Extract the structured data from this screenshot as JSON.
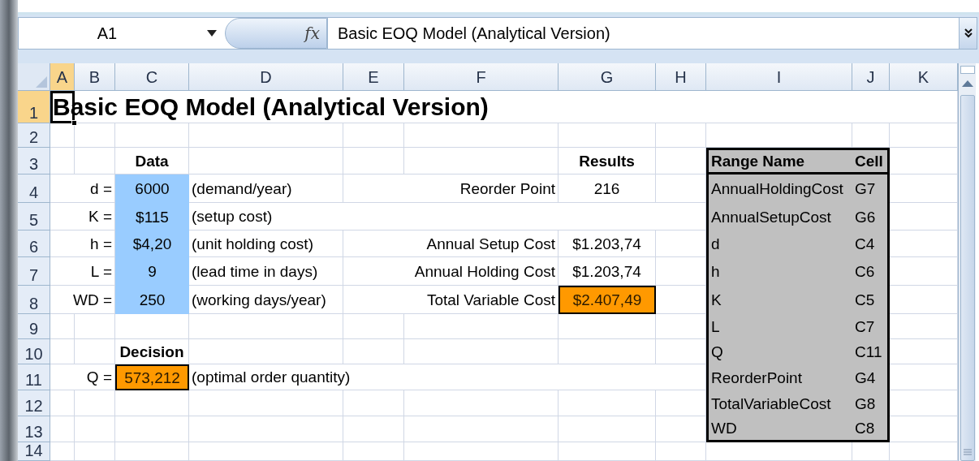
{
  "formula_bar": {
    "name_box": "A1",
    "function_label": "fx",
    "formula": "Basic EOQ Model (Analytical Version)"
  },
  "columns": [
    {
      "label": "A",
      "selected": true
    },
    {
      "label": "B",
      "selected": false
    },
    {
      "label": "C",
      "selected": false
    },
    {
      "label": "D",
      "selected": false
    },
    {
      "label": "E",
      "selected": false
    },
    {
      "label": "F",
      "selected": false
    },
    {
      "label": "G",
      "selected": false
    },
    {
      "label": "H",
      "selected": false
    },
    {
      "label": "I",
      "selected": false
    },
    {
      "label": "J",
      "selected": false
    },
    {
      "label": "K",
      "selected": false
    }
  ],
  "rows": [
    {
      "number": "1",
      "selected": true,
      "cells": {
        "A": {
          "text": "Basic EOQ Model (Analytical Version)",
          "kind": "title",
          "selected": true
        }
      }
    },
    {
      "number": "2",
      "selected": false
    },
    {
      "number": "3",
      "selected": false,
      "cells": {
        "C": {
          "text": "Data",
          "kind": "header",
          "selected": false
        },
        "G": {
          "text": "Results",
          "kind": "header",
          "selected": false
        },
        "I": {
          "text": "Range Name",
          "kind": "range_header",
          "selected": false
        },
        "J": {
          "text": "Cell",
          "kind": "range_header",
          "selected": false
        }
      }
    },
    {
      "number": "4",
      "selected": false,
      "cells": {
        "B": {
          "text": "d =",
          "kind": "label",
          "selected": false
        },
        "C": {
          "text": "6000",
          "kind": "input",
          "selected": false
        },
        "D": {
          "text": "(demand/year)",
          "kind": "note",
          "selected": false
        },
        "F": {
          "text": "Reorder Point",
          "kind": "label",
          "selected": false
        },
        "G": {
          "text": "216",
          "kind": "value",
          "selected": false
        },
        "I": {
          "text": "AnnualHoldingCost",
          "kind": "range",
          "selected": false
        },
        "J": {
          "text": "G7",
          "kind": "range",
          "selected": false
        }
      }
    },
    {
      "number": "5",
      "selected": false,
      "cells": {
        "B": {
          "text": "K =",
          "kind": "label",
          "selected": false
        },
        "C": {
          "text": "$115",
          "kind": "input",
          "selected": false
        },
        "D": {
          "text": "(setup cost)",
          "kind": "note",
          "selected": false
        },
        "I": {
          "text": "AnnualSetupCost",
          "kind": "range",
          "selected": false
        },
        "J": {
          "text": "G6",
          "kind": "range",
          "selected": false
        }
      }
    },
    {
      "number": "6",
      "selected": false,
      "cells": {
        "B": {
          "text": "h =",
          "kind": "label",
          "selected": false
        },
        "C": {
          "text": "$4,20",
          "kind": "input",
          "selected": false
        },
        "D": {
          "text": "(unit holding cost)",
          "kind": "note",
          "selected": false
        },
        "F": {
          "text": "Annual Setup Cost",
          "kind": "label",
          "selected": false
        },
        "G": {
          "text": "$1.203,74",
          "kind": "value",
          "selected": false
        },
        "I": {
          "text": "d",
          "kind": "range",
          "selected": false
        },
        "J": {
          "text": "C4",
          "kind": "range",
          "selected": false
        }
      }
    },
    {
      "number": "7",
      "selected": false,
      "cells": {
        "B": {
          "text": "L =",
          "kind": "label",
          "selected": false
        },
        "C": {
          "text": "9",
          "kind": "input",
          "selected": false
        },
        "D": {
          "text": "(lead time in days)",
          "kind": "note",
          "selected": false
        },
        "F": {
          "text": "Annual Holding Cost",
          "kind": "label",
          "selected": false
        },
        "G": {
          "text": "$1.203,74",
          "kind": "value",
          "selected": false
        },
        "I": {
          "text": "h",
          "kind": "range",
          "selected": false
        },
        "J": {
          "text": "C6",
          "kind": "range",
          "selected": false
        }
      }
    },
    {
      "number": "8",
      "selected": false,
      "cells": {
        "B": {
          "text": "WD =",
          "kind": "label",
          "selected": false
        },
        "C": {
          "text": "250",
          "kind": "input",
          "selected": false
        },
        "D": {
          "text": "(working days/year)",
          "kind": "note",
          "selected": false
        },
        "F": {
          "text": "Total Variable Cost",
          "kind": "label",
          "selected": false
        },
        "G": {
          "text": "$2.407,49",
          "kind": "output",
          "selected": false
        },
        "I": {
          "text": "K",
          "kind": "range",
          "selected": false
        },
        "J": {
          "text": "C5",
          "kind": "range",
          "selected": false
        }
      }
    },
    {
      "number": "9",
      "selected": false,
      "cells": {
        "I": {
          "text": "L",
          "kind": "range",
          "selected": false
        },
        "J": {
          "text": "C7",
          "kind": "range",
          "selected": false
        }
      }
    },
    {
      "number": "10",
      "selected": false,
      "cells": {
        "C": {
          "text": "Decision",
          "kind": "header",
          "selected": false
        },
        "I": {
          "text": "Q",
          "kind": "range",
          "selected": false
        },
        "J": {
          "text": "C11",
          "kind": "range",
          "selected": false
        }
      }
    },
    {
      "number": "11",
      "selected": false,
      "cells": {
        "B": {
          "text": "Q =",
          "kind": "label",
          "selected": false
        },
        "C": {
          "text": "573,212",
          "kind": "output",
          "selected": false
        },
        "D": {
          "text": "(optimal order quantity)",
          "kind": "note",
          "selected": false
        },
        "I": {
          "text": "ReorderPoint",
          "kind": "range",
          "selected": false
        },
        "J": {
          "text": "G4",
          "kind": "range",
          "selected": false
        }
      }
    },
    {
      "number": "12",
      "selected": false,
      "cells": {
        "I": {
          "text": "TotalVariableCost",
          "kind": "range",
          "selected": false
        },
        "J": {
          "text": "G8",
          "kind": "range",
          "selected": false
        }
      }
    },
    {
      "number": "13",
      "selected": false,
      "cells": {
        "I": {
          "text": "WD",
          "kind": "range",
          "selected": false
        },
        "J": {
          "text": "C8",
          "kind": "range",
          "selected": false
        }
      }
    },
    {
      "number": "14",
      "selected": false
    }
  ]
}
